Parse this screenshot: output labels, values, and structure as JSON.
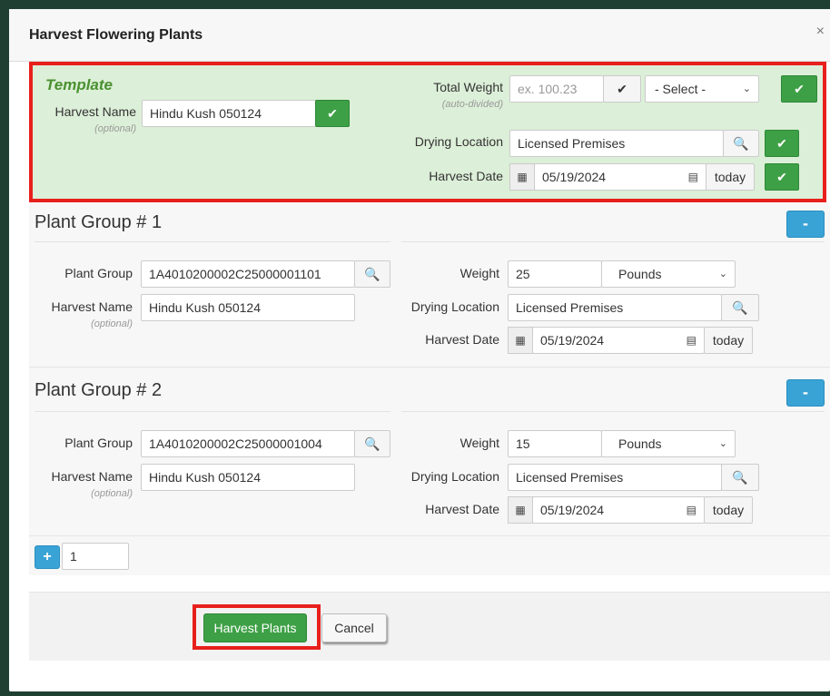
{
  "dialog": {
    "title": "Harvest Flowering Plants",
    "close_glyph": "×"
  },
  "template": {
    "heading": "Template",
    "harvest_name_label": "Harvest Name",
    "harvest_name_hint": "(optional)",
    "harvest_name_value": "Hindu Kush 050124",
    "total_weight_label": "Total Weight",
    "total_weight_hint": "(auto-divided)",
    "total_weight_placeholder": "ex. 100.23",
    "unit_select_value": "- Select -",
    "drying_location_label": "Drying Location",
    "drying_location_value": "Licensed Premises",
    "harvest_date_label": "Harvest Date",
    "harvest_date_value": "05/19/2024",
    "today_label": "today"
  },
  "groups": [
    {
      "title": "Plant Group # 1",
      "plant_group_label": "Plant Group",
      "plant_group_value": "1A4010200002C25000001101",
      "harvest_name_label": "Harvest Name",
      "harvest_name_hint": "(optional)",
      "harvest_name_value": "Hindu Kush 050124",
      "weight_label": "Weight",
      "weight_value": "25",
      "unit_value": "Pounds",
      "drying_location_label": "Drying Location",
      "drying_location_value": "Licensed Premises",
      "harvest_date_label": "Harvest Date",
      "harvest_date_value": "05/19/2024",
      "today_label": "today",
      "remove_glyph": "-"
    },
    {
      "title": "Plant Group # 2",
      "plant_group_label": "Plant Group",
      "plant_group_value": "1A4010200002C25000001004",
      "harvest_name_label": "Harvest Name",
      "harvest_name_hint": "(optional)",
      "harvest_name_value": "Hindu Kush 050124",
      "weight_label": "Weight",
      "weight_value": "15",
      "unit_value": "Pounds",
      "drying_location_label": "Drying Location",
      "drying_location_value": "Licensed Premises",
      "harvest_date_label": "Harvest Date",
      "harvest_date_value": "05/19/2024",
      "today_label": "today",
      "remove_glyph": "-"
    }
  ],
  "add_row": {
    "plus_glyph": "+",
    "count_value": "1"
  },
  "footer": {
    "harvest_label": "Harvest Plants",
    "cancel_label": "Cancel"
  },
  "colors": {
    "accent_green": "#3ea046",
    "highlight_red": "#e8201c",
    "template_bg": "#dcefd8",
    "blue_button": "#3aa3d6"
  },
  "icons": {
    "check": "check-icon",
    "search": "search-icon",
    "calendar": "calendar-icon",
    "date_picker": "date-picker-icon",
    "chevron": "chevron-down-icon"
  }
}
